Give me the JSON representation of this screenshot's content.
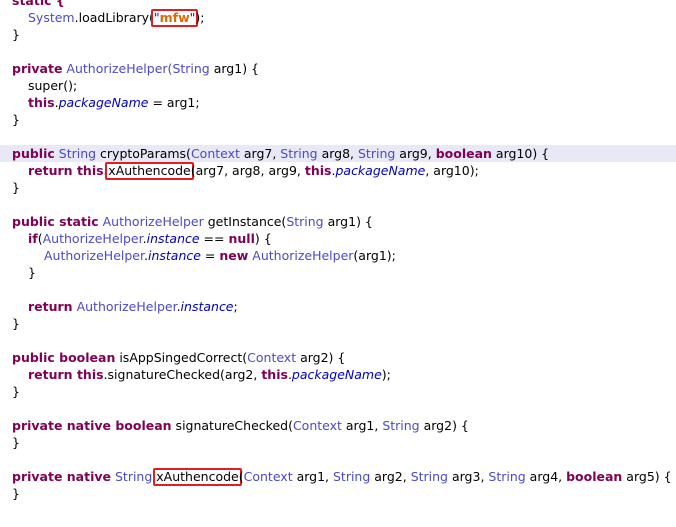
{
  "lines": {
    "l0": {
      "a": "static {"
    },
    "l1": {
      "a": "System",
      "b": ".loadLibrary(",
      "c": "\"",
      "d": "mfw",
      "e": "\"",
      "f": ");"
    },
    "l2": {
      "a": "}"
    },
    "l4": {
      "a": "private",
      "b": " AuthorizeHelper(",
      "c": "String",
      "d": " arg1) {"
    },
    "l5": {
      "a": "super();"
    },
    "l6": {
      "a": "this",
      "b": ".",
      "c": "packageName",
      "d": " = arg1;"
    },
    "l7": {
      "a": "}"
    },
    "l9": {
      "a": "public",
      "b": " String",
      "c": " cryptoParams(",
      "d": "Context",
      "e": " arg7, ",
      "f": "String",
      "g": " arg8, ",
      "h": "String",
      "i": " arg9, ",
      "j": "boolean",
      "k": " arg10) {"
    },
    "l10": {
      "a": "return",
      "b": " this.",
      "c": "xAuthencode",
      "d": "(arg7, arg8, arg9, ",
      "e": "this",
      "f": ".",
      "g": "packageName",
      "h": ", arg10);"
    },
    "l11": {
      "a": "}"
    },
    "l13": {
      "a": "public static",
      "b": " AuthorizeHelper",
      "c": " getInstance(",
      "d": "String",
      "e": " arg1) {"
    },
    "l14": {
      "a": "if",
      "b": "(",
      "c": "AuthorizeHelper",
      "d": ".",
      "e": "instance",
      "f": " == ",
      "g": "null",
      "h": ") {"
    },
    "l15": {
      "a": "AuthorizeHelper",
      "b": ".",
      "c": "instance",
      "d": " = ",
      "e": "new",
      "f": " AuthorizeHelper",
      "g": "(arg1);"
    },
    "l16": {
      "a": "}"
    },
    "l18": {
      "a": "return",
      "b": " AuthorizeHelper",
      "c": ".",
      "d": "instance",
      "e": ";"
    },
    "l19": {
      "a": "}"
    },
    "l21": {
      "a": "public boolean",
      "b": " isAppSingedCorrect(",
      "c": "Context",
      "d": " arg2) {"
    },
    "l22": {
      "a": "return",
      "b": " this",
      "c": ".signatureChecked(arg2, ",
      "d": "this",
      "e": ".",
      "f": "packageName",
      "g": ");"
    },
    "l23": {
      "a": "}"
    },
    "l25": {
      "a": "private native boolean",
      "b": " signatureChecked(",
      "c": "Context",
      "d": " arg1, ",
      "e": "String",
      "f": " arg2) {"
    },
    "l26": {
      "a": "}"
    },
    "l28": {
      "a": "private native",
      "b": " String",
      "c": "xAuthencode",
      "d": "(",
      "e": "Context",
      "f": " arg1, ",
      "g": "String",
      "h": " arg2, ",
      "i": "String",
      "j": " arg3, ",
      "k": "String",
      "l": " arg4, ",
      "m": "boolean",
      "n": " arg5) {"
    },
    "l29": {
      "a": "}"
    }
  }
}
